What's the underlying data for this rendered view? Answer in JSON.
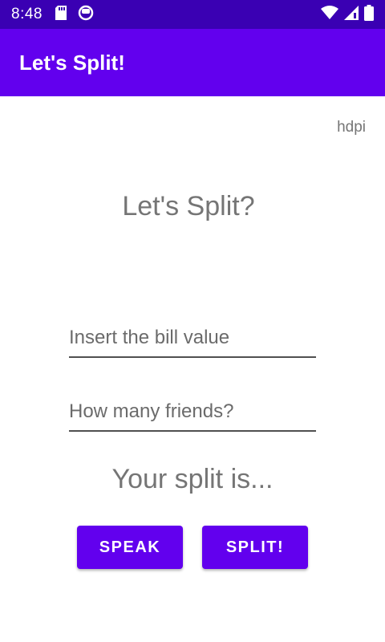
{
  "status_bar": {
    "time": "8:48",
    "left_icons": [
      "sd-card-icon",
      "app-notification-icon"
    ],
    "right_icons": [
      "wifi-icon",
      "cell-signal-icon",
      "battery-icon"
    ]
  },
  "app_bar": {
    "title": "Let's Split!"
  },
  "density_label": "hdpi",
  "heading": "Let's Split?",
  "form": {
    "bill_placeholder": "Insert the bill value",
    "friends_placeholder": "How many friends?"
  },
  "result_text": "Your split is...",
  "buttons": {
    "speak": "SPEAK",
    "split": "SPLIT!"
  },
  "colors": {
    "status_bar": "#3a00b3",
    "primary": "#6200ee",
    "secondary_text": "#757575"
  }
}
